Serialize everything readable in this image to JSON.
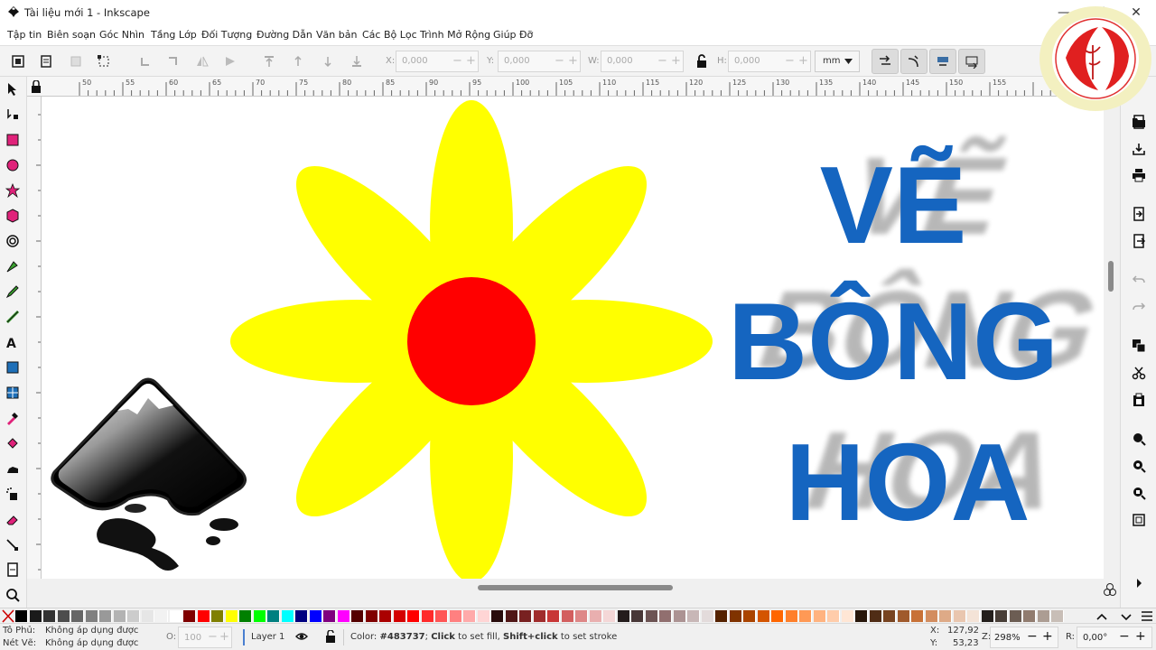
{
  "window": {
    "title": "Tài liệu mới 1 - Inkscape",
    "minimize": "—",
    "maximize": "☐",
    "close": "✕"
  },
  "menu": [
    "Tập tin",
    "Biên soạn",
    "Góc Nhìn",
    "Tầng Lớp",
    "Đối Tượng",
    "Đường Dẫn",
    "Văn bản",
    "Các Bộ Lọc",
    "Trình Mở Rộng",
    "Giúp Đỡ"
  ],
  "toolbar": {
    "x_label": "X:",
    "x_value": "0,000",
    "y_label": "Y:",
    "y_value": "0,000",
    "w_label": "W:",
    "w_value": "0,000",
    "h_label": "H:",
    "h_value": "0,000",
    "unit": "mm"
  },
  "ruler_labels": [
    "50",
    "55",
    "60",
    "65",
    "70",
    "75",
    "80",
    "85",
    "90",
    "95",
    "100",
    "105",
    "110",
    "115",
    "120",
    "125",
    "130",
    "135",
    "140",
    "145",
    "150",
    "155"
  ],
  "canvas": {
    "heading_line1": "VẼ",
    "heading_line2": "BÔNG",
    "heading_line3": "HOA",
    "petal_color": "#ffff00",
    "center_color": "#ff0000",
    "text_color": "#1565c0"
  },
  "status": {
    "fill_label": "Tô Phủ:",
    "fill_value": "Không áp dụng được",
    "stroke_label": "Nét Vẽ:",
    "stroke_value": "Không áp dụng được",
    "opacity_label": "O:",
    "opacity_value": "100",
    "layer": "Layer 1",
    "message_pre": "Color: ",
    "message_code": "#483737",
    "message_sep1": "; ",
    "message_click": "Click",
    "message_mid": " to set fill, ",
    "message_shift": "Shift+click",
    "message_end": " to set stroke",
    "x_label": "X:",
    "x_value": "127,92",
    "y_label": "Y:",
    "y_value": "53,23",
    "zoom_label": "Z:",
    "zoom_value": "298%",
    "rot_label": "R:",
    "rot_value": "0,00°"
  },
  "palette": [
    "#000000",
    "#1a1a1a",
    "#333333",
    "#4d4d4d",
    "#666666",
    "#808080",
    "#999999",
    "#b3b3b3",
    "#cccccc",
    "#e6e6e6",
    "#f2f2f2",
    "#ffffff",
    "#800000",
    "#ff0000",
    "#808000",
    "#ffff00",
    "#008000",
    "#00ff00",
    "#008080",
    "#00ffff",
    "#000080",
    "#0000ff",
    "#800080",
    "#ff00ff",
    "#550000",
    "#800000",
    "#aa0000",
    "#d40000",
    "#ff0000",
    "#ff2a2a",
    "#ff5555",
    "#ff8080",
    "#ffaaaa",
    "#ffd5d5",
    "#280b0b",
    "#501616",
    "#782121",
    "#a02c2c",
    "#c83737",
    "#d35f5f",
    "#de8787",
    "#e9afaf",
    "#f4d7d7",
    "#241c1c",
    "#483737",
    "#6c5353",
    "#916f6f",
    "#ac9393",
    "#c8b7b7",
    "#e3dbdb",
    "#552200",
    "#803300",
    "#aa4400",
    "#d45500",
    "#ff6600",
    "#ff7f2a",
    "#ff9955",
    "#ffb380",
    "#ffccaa",
    "#ffe6d5",
    "#28170b",
    "#502d16",
    "#784421",
    "#a05a2c",
    "#c87137",
    "#d38d5f",
    "#deaa87",
    "#e9c6af",
    "#f4e3d7",
    "#241f1c",
    "#483e37",
    "#6c5d53",
    "#917c6f",
    "#ac9d93",
    "#c8beb7"
  ]
}
